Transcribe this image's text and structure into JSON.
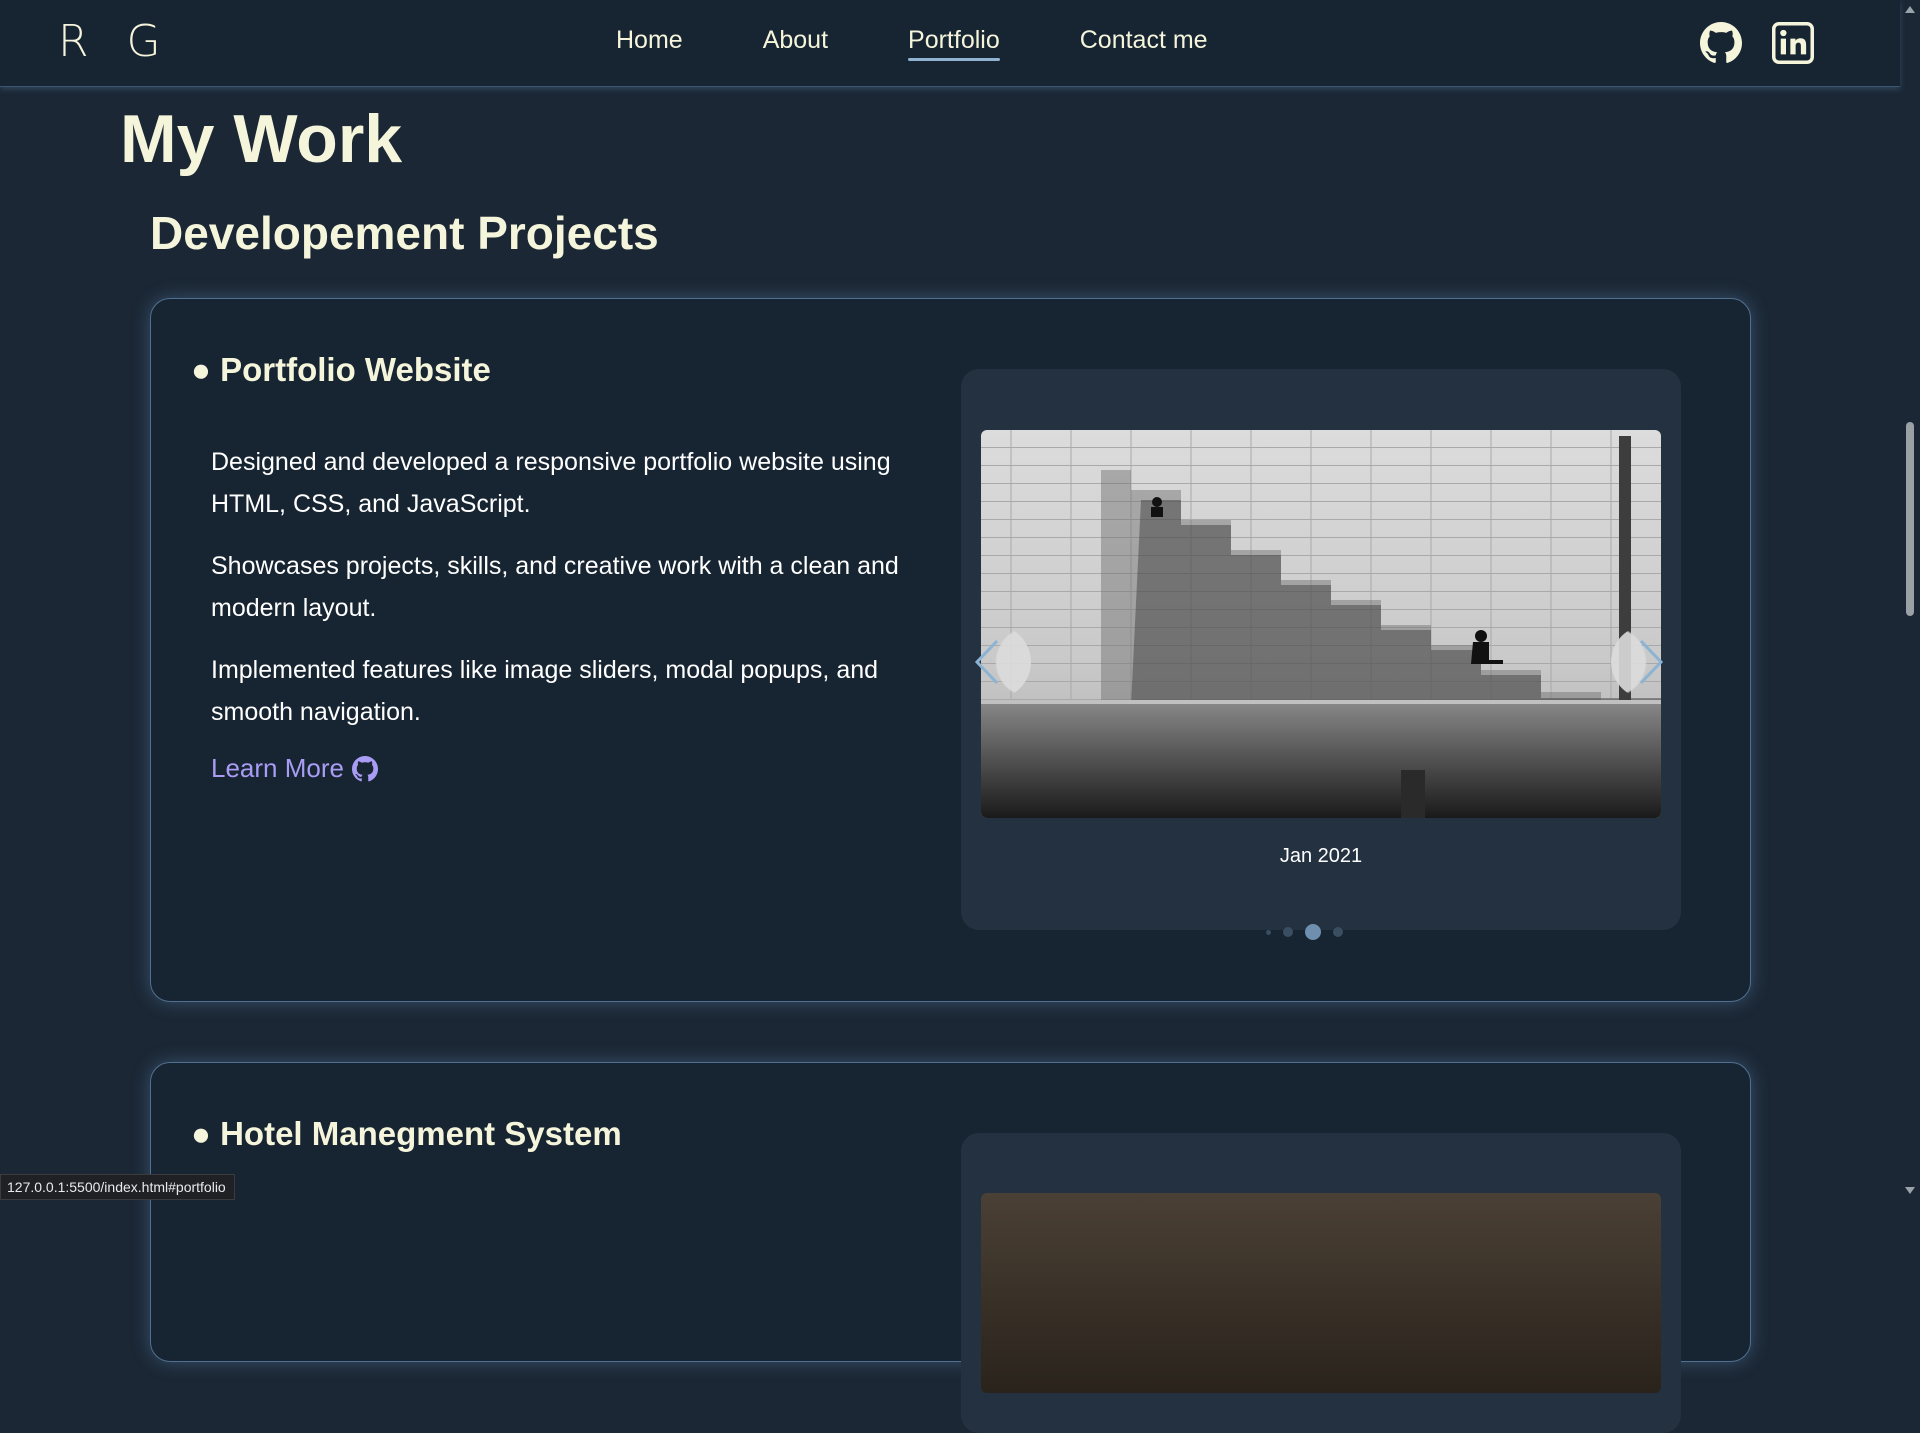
{
  "nav": {
    "logo": "R G",
    "links": [
      {
        "label": "Home",
        "active": false
      },
      {
        "label": "About",
        "active": false
      },
      {
        "label": "Portfolio",
        "active": true
      },
      {
        "label": "Contact me",
        "active": false
      }
    ],
    "social": [
      "github-icon",
      "linkedin-icon"
    ]
  },
  "page": {
    "title": "My Work",
    "section_title": "Developement Projects"
  },
  "projects": [
    {
      "title": "● Portfolio Website",
      "paragraphs": [
        "Designed and developed a responsive portfolio website using HTML, CSS, and JavaScript.",
        "Showcases projects, skills, and creative work with a clean and modern layout.",
        "Implemented features like image sliders, modal popups, and smooth navigation."
      ],
      "link_label": "Learn More",
      "slide_caption": "Jan 2021",
      "slides_count": 4,
      "active_slide": 3
    },
    {
      "title": "● Hotel Manegment System"
    }
  ],
  "status_url": "127.0.0.1:5500/index.html#portfolio",
  "colors": {
    "background": "#1b2735",
    "text": "#f5f5dc",
    "link": "#a89cf5",
    "card_border": "#4f7090"
  }
}
